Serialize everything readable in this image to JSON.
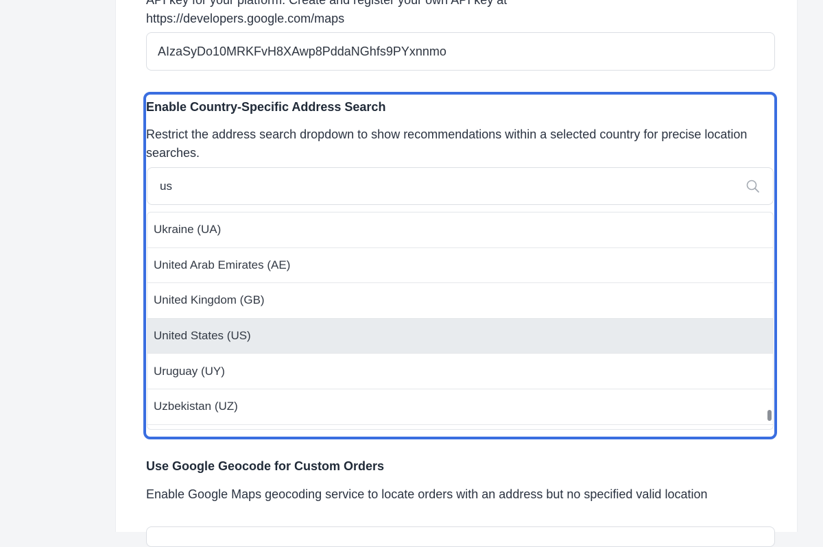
{
  "api_key_section": {
    "desc_clipped": "API key for your platform. Create and register your own API key at",
    "desc_url": "https://developers.google.com/maps",
    "key_value": "AIzaSyDo10MRKFvH8XAwp8PddaNGhfs9PYxnnmo"
  },
  "country_search": {
    "title": "Enable Country-Specific Address Search",
    "description": "Restrict the address search dropdown to show recommendations within a selected country for precise location searches.",
    "search_value": "us",
    "search_icon": "search-icon",
    "options": [
      {
        "label": "Ukraine (UA)"
      },
      {
        "label": "United Arab Emirates (AE)"
      },
      {
        "label": "United Kingdom (GB)"
      },
      {
        "label": "United States (US)"
      },
      {
        "label": "Uruguay (UY)"
      },
      {
        "label": "Uzbekistan (UZ)"
      }
    ],
    "active_option": "United States (US)"
  },
  "geocode_section": {
    "title": "Use Google Geocode for Custom Orders",
    "description": "Enable Google Maps geocoding service to locate orders with an address but no specified valid location"
  },
  "colors": {
    "highlight": "#3a6ee0",
    "active_row": "#e8ebee"
  }
}
